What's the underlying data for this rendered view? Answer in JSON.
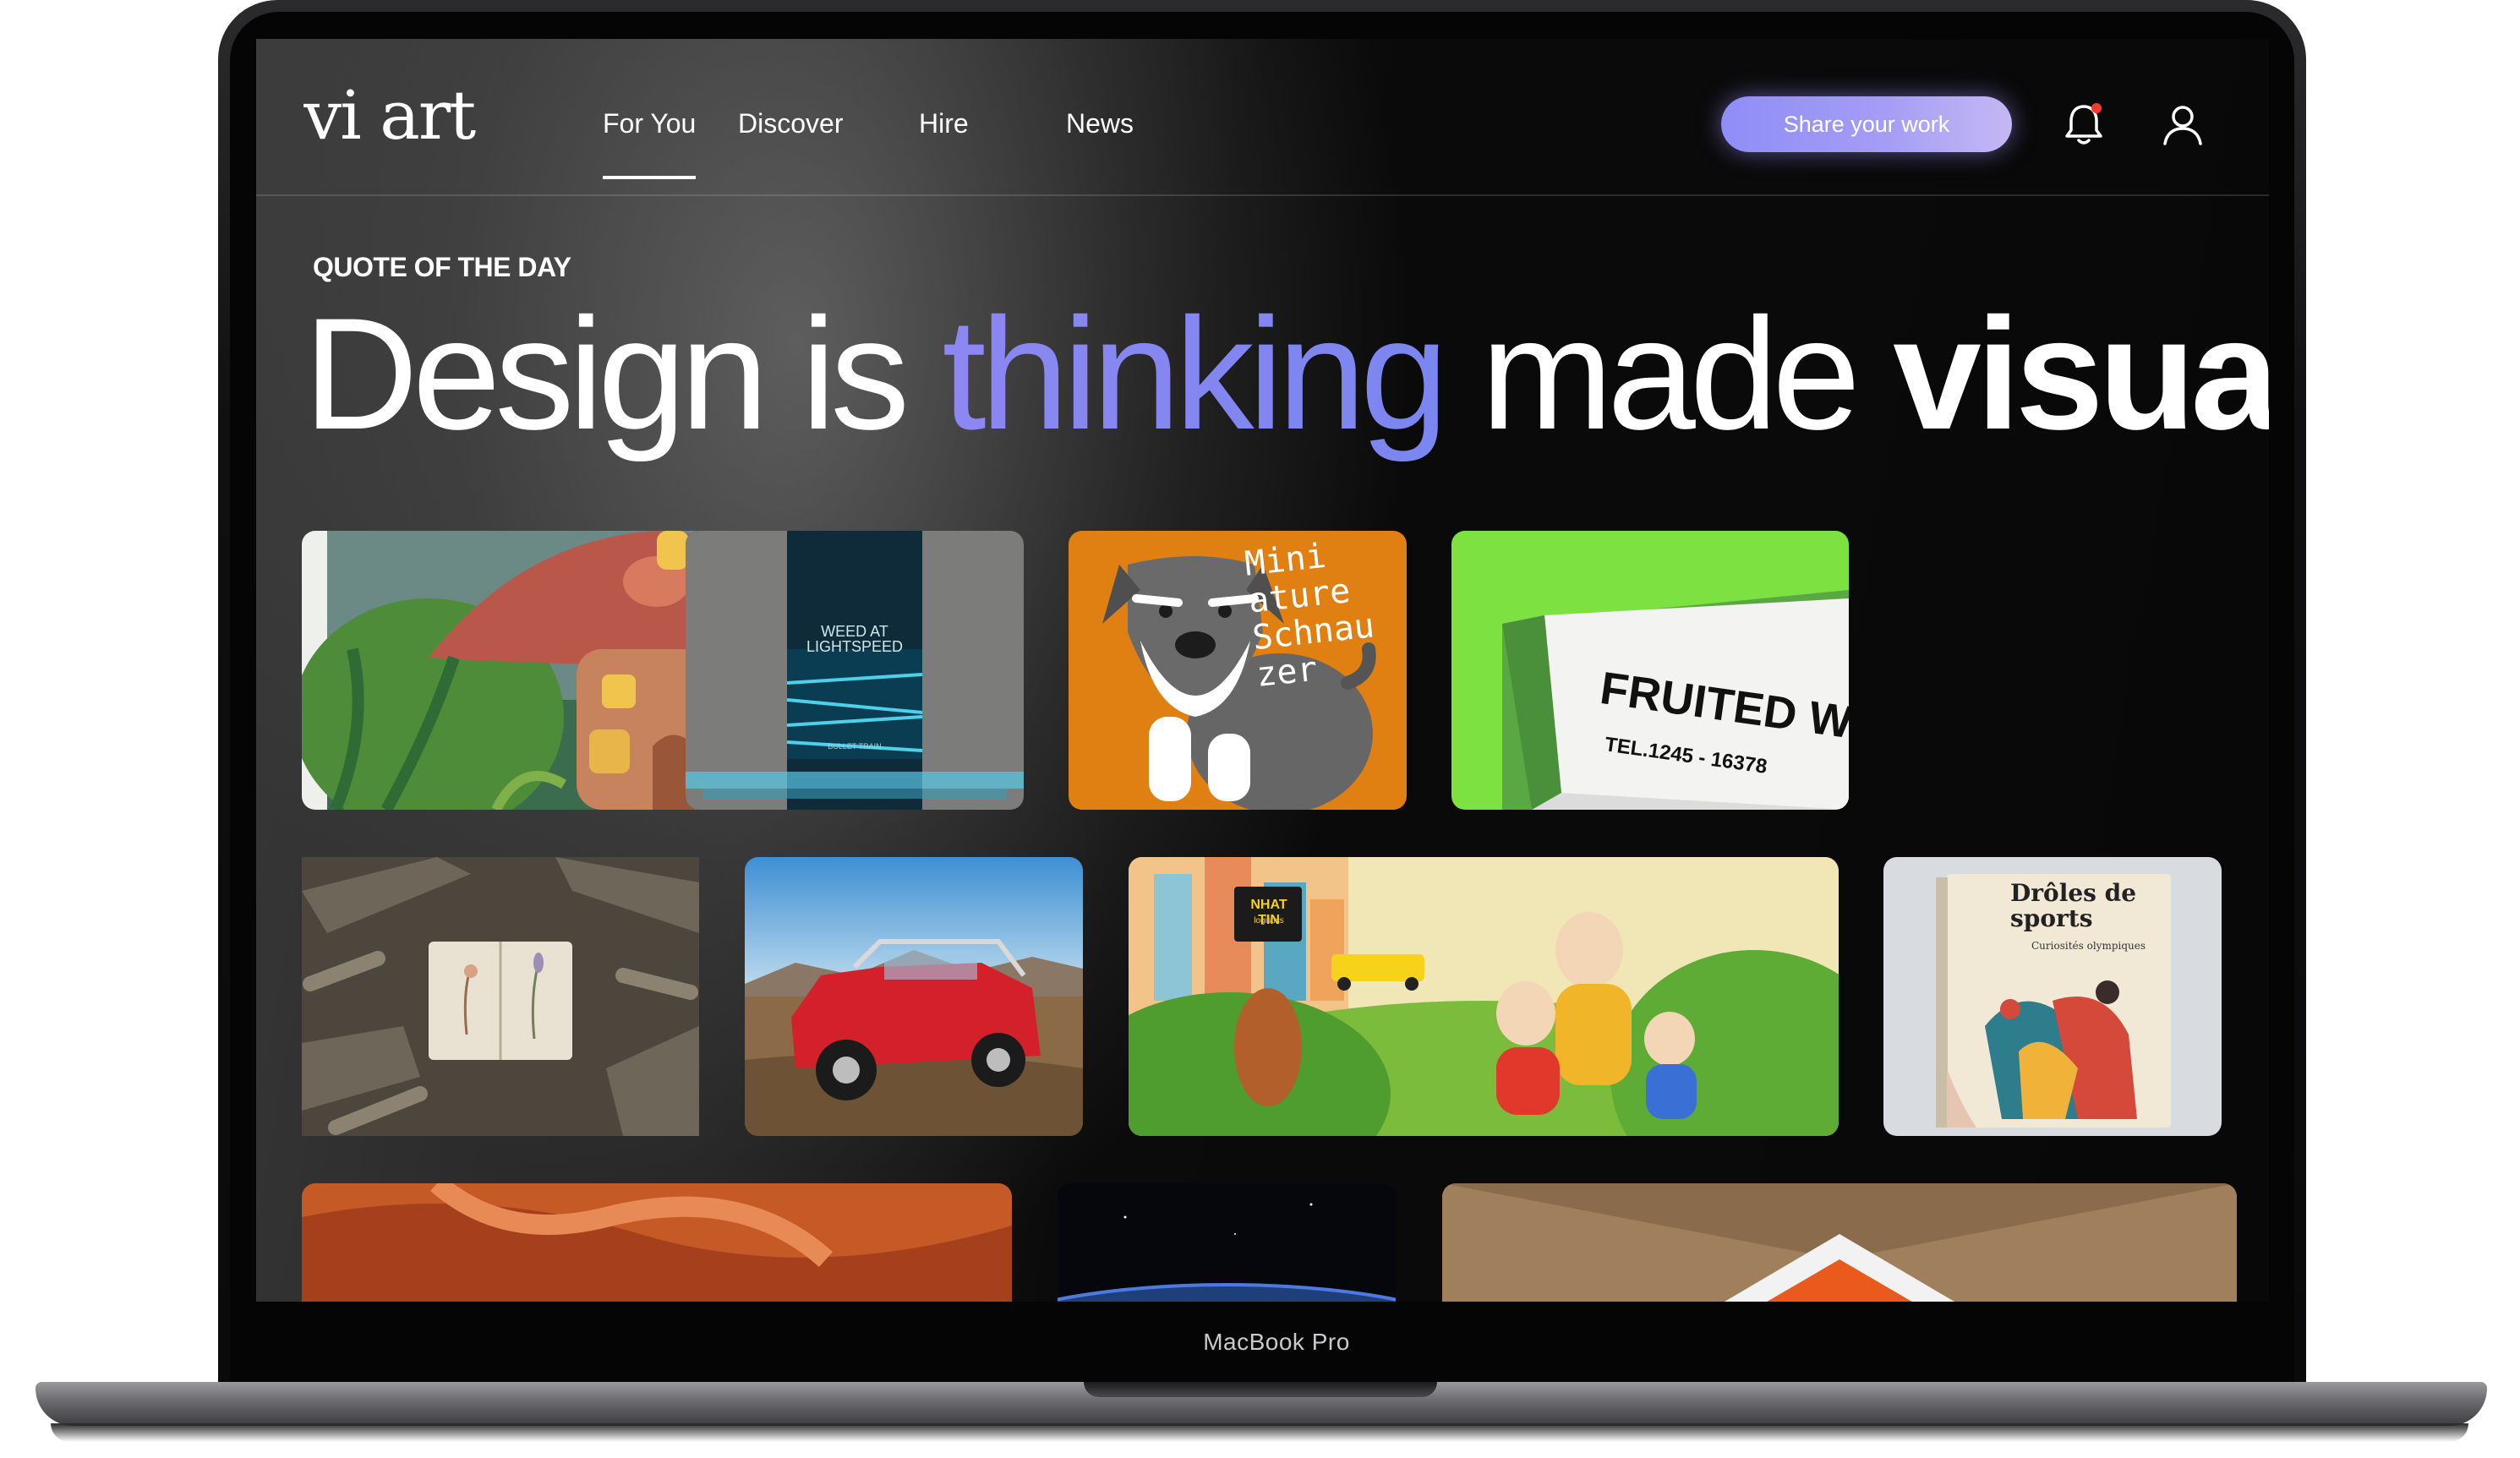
{
  "device": {
    "label": "MacBook Pro"
  },
  "app": {
    "logo": "vi art",
    "nav": {
      "items": [
        {
          "label": "For You",
          "active": true
        },
        {
          "label": "Discover",
          "active": false
        },
        {
          "label": "Hire",
          "active": false
        },
        {
          "label": "News",
          "active": false
        }
      ],
      "share_button": "Share your work",
      "icons": [
        "bell-icon",
        "user-icon"
      ],
      "notification_dot_color": "#ff3b30"
    },
    "hero": {
      "kicker": "QUOTE OF THE DAY",
      "headline": {
        "part1": "Design is ",
        "accent": "thinking",
        "part2": " made ",
        "bold": "visual"
      },
      "accent_color": "#8d87f2"
    },
    "gallery": {
      "cards": [
        {
          "subject": "mushroom-house-illustration"
        },
        {
          "subject": "elevator-poster",
          "text_main": "WEED AT LIGHTSPEED",
          "text_small": "BULLET TRAIN"
        },
        {
          "subject": "schnauzer-illustration",
          "text_main": "Mini ature Schnau zer"
        },
        {
          "subject": "fruited-sign-mockup",
          "text_main": "FRUITED W",
          "text_small": "TEL.1245 - 16378"
        },
        {
          "subject": "botanical-sketchbook"
        },
        {
          "subject": "red-jeep-photo"
        },
        {
          "subject": "garden-family-illustration",
          "text_main": "NHAT TIN",
          "text_small": "logistics"
        },
        {
          "subject": "book-cover",
          "text_main": "Drôles de sports",
          "text_small": "Curiosités olympiques"
        },
        {
          "subject": "orange-fabric-photo"
        },
        {
          "subject": "earth-space-photo"
        },
        {
          "subject": "orange-triangle-photo"
        }
      ]
    }
  }
}
